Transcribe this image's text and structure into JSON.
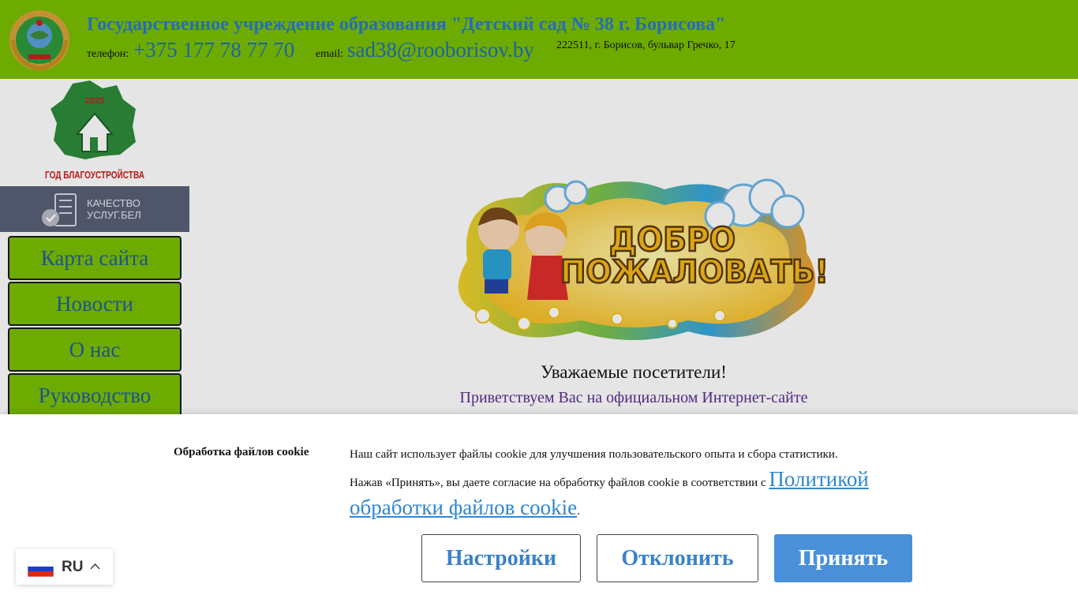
{
  "header": {
    "org_title": "Государственное учреждение образования \"Детский сад № 38 г. Борисова\"",
    "phone_label": "телефон:",
    "phone": "+375 177 78 77 70",
    "email_label": "email:",
    "email": "sad38@rooborisov.by",
    "address": "222511, г. Борисов, бульвар Гречко, 17"
  },
  "sidebar": {
    "logo": {
      "year": "2025",
      "caption": "ГОД БЛАГОУСТРОЙСТВА"
    },
    "quality_banner": {
      "line1": "КАЧЕСТВО",
      "line2": "УСЛУГ.БЕЛ"
    },
    "nav": [
      {
        "label": "Карта сайта"
      },
      {
        "label": "Новости"
      },
      {
        "label": "О нас"
      },
      {
        "label": "Руководство"
      }
    ]
  },
  "main": {
    "welcome_image_text": {
      "line1": "ДОБРО",
      "line2": "ПОЖАЛОВАТЬ!"
    },
    "greeting": "Уважаемые посетители!",
    "welcome_line": "Приветствуем Вас на официальном Интернет-сайте"
  },
  "cookie": {
    "title": "Обработка файлов cookie",
    "text_line1": "Наш сайт использует файлы cookie для улучшения пользовательского опыта и сбора статистики.",
    "text_line2": "Нажав «Принять», вы даете согласие на обработку файлов cookie в соответствии с ",
    "policy_link": "Политикой обработки файлов cookie",
    "text_end": ".",
    "settings_label": "Настройки",
    "decline_label": "Отклонить",
    "accept_label": "Принять"
  },
  "language": {
    "code": "RU"
  },
  "colors": {
    "header_bg": "#7bbf00",
    "nav_bg": "#7bbf00",
    "title_blue": "#2a7bc4",
    "link_blue": "#2f86cf",
    "accept_bg": "#4a90d9",
    "quality_bg": "#5a6076",
    "welcome_purple": "#5a2e8f"
  },
  "icons": {
    "emblem": "belarus-emblem-icon",
    "logo": "year-of-improvement-logo",
    "quality": "building-check-icon",
    "flag": "russia-flag-icon",
    "chevron": "chevron-up-icon"
  }
}
